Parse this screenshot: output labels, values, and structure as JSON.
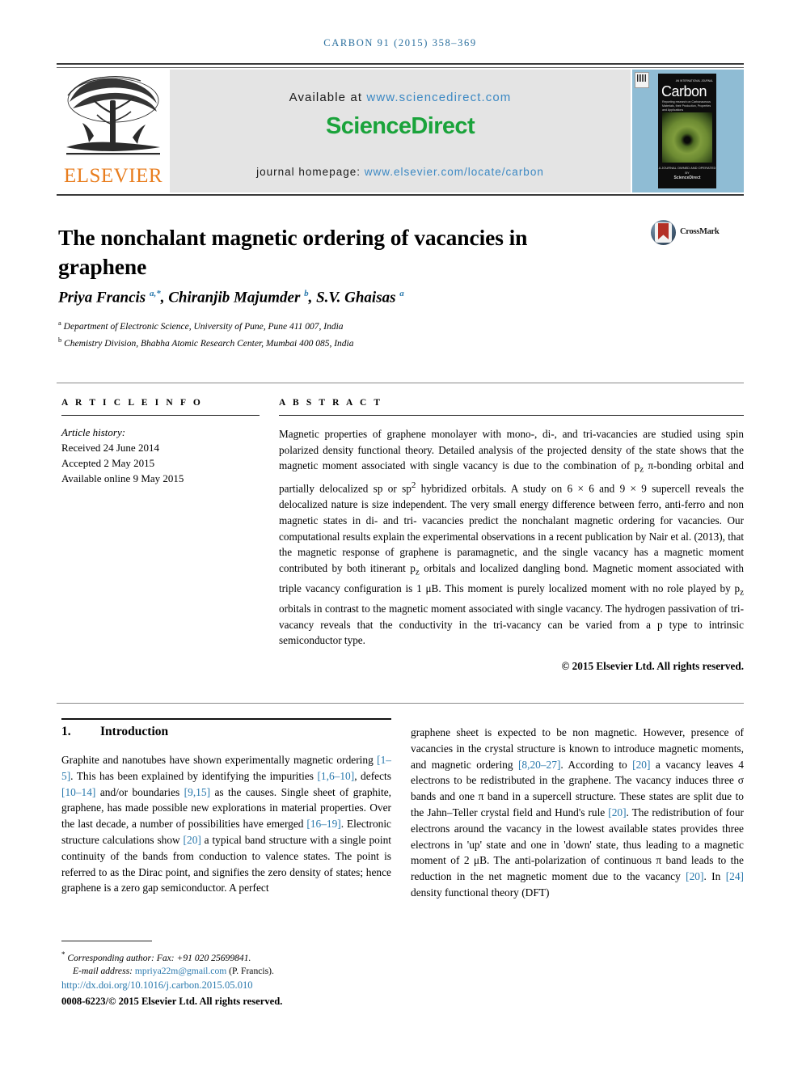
{
  "running_head": "CARBON 91 (2015) 358–369",
  "masthead": {
    "publisher_name": "ELSEVIER",
    "available_prefix": "Available at",
    "available_url": "www.sciencedirect.com",
    "sciencedirect_logo": "ScienceDirect",
    "homepage_prefix": "journal homepage:",
    "homepage_url": "www.elsevier.com/locate/carbon",
    "cover": {
      "journal_title": "Carbon",
      "tagline_top": "AN INTERNATIONAL JOURNAL",
      "subtitle": "Reporting research on Carbonaceous Materials, their Production, Properties and Applications",
      "footer_small": "A JOURNAL OWNED AND OPERATED BY",
      "footer_brand": "ScienceDirect"
    }
  },
  "article": {
    "title": "The nonchalant magnetic ordering of vacancies in graphene",
    "crossmark_label": "CrossMark",
    "authors_html": "Priya Francis <sup>a,*</sup>, Chiranjib Majumder <sup>b</sup>, S.V. Ghaisas <sup>a</sup>",
    "affiliations": [
      "Department of Electronic Science, University of Pune, Pune 411 007, India",
      "Chemistry Division, Bhabha Atomic Research Center, Mumbai 400 085, India"
    ],
    "affiliation_markers": [
      "a",
      "b"
    ]
  },
  "article_info": {
    "heading": "A R T I C L E   I N F O",
    "history_label": "Article history:",
    "history": [
      "Received 24 June 2014",
      "Accepted 2 May 2015",
      "Available online 9 May 2015"
    ]
  },
  "abstract": {
    "heading": "A B S T R A C T",
    "text": "Magnetic properties of graphene monolayer with mono-, di-, and tri-vacancies are studied using spin polarized density functional theory. Detailed analysis of the projected density of the state shows that the magnetic moment associated with single vacancy is due to the combination of pz π-bonding orbital and partially delocalized sp or sp2 hybridized orbitals. A study on 6 × 6 and 9 × 9 supercell reveals the delocalized nature is size independent. The very small energy difference between ferro, anti-ferro and non magnetic states in di- and tri- vacancies predict the nonchalant magnetic ordering for vacancies. Our computational results explain the experimental observations in a recent publication by Nair et al. (2013), that the magnetic response of graphene is paramagnetic, and the single vacancy has a magnetic moment contributed by both itinerant pz orbitals and localized dangling bond. Magnetic moment associated with triple vacancy configuration is 1 μB. This moment is purely localized moment with no role played by pz orbitals in contrast to the magnetic moment associated with single vacancy. The hydrogen passivation of tri-vacancy reveals that the conductivity in the tri-vacancy can be varied from a p type to intrinsic semiconductor type.",
    "copyright": "© 2015 Elsevier Ltd. All rights reserved."
  },
  "body": {
    "section_number": "1.",
    "section_title": "Introduction",
    "left_column_text": "Graphite and nanotubes have shown experimentally magnetic ordering [1–5]. This has been explained by identifying the impurities [1,6–10], defects [10–14] and/or boundaries [9,15] as the causes. Single sheet of graphite, graphene, has made possible new explorations in material properties. Over the last decade, a number of possibilities have emerged [16–19]. Electronic structure calculations show [20] a typical band structure with a single point continuity of the bands from conduction to valence states. The point is referred to as the Dirac point, and signifies the zero density of states; hence graphene is a zero gap semiconductor. A perfect",
    "right_column_text": "graphene sheet is expected to be non magnetic. However, presence of vacancies in the crystal structure is known to introduce magnetic moments, and magnetic ordering [8,20–27]. According to [20] a vacancy leaves 4 electrons to be redistributed in the graphene. The vacancy induces three σ bands and one π band in a supercell structure. These states are split due to the Jahn–Teller crystal field and Hund's rule [20]. The redistribution of four electrons around the vacancy in the lowest available states provides three electrons in 'up' state and one in 'down' state, thus leading to a magnetic moment of 2 μB. The anti-polarization of continuous π band leads to the reduction in the net magnetic moment due to the vacancy [20]. In [24] density functional theory (DFT)"
  },
  "footer": {
    "corresponding_marker": "*",
    "corresponding_text": "Corresponding author: Fax: +91 020 25699841.",
    "email_label": "E-mail address:",
    "email": "mpriya22m@gmail.com",
    "email_owner": "(P. Francis).",
    "doi": "http://dx.doi.org/10.1016/j.carbon.2015.05.010",
    "issn_line": "0008-6223/© 2015 Elsevier Ltd. All rights reserved."
  },
  "colors": {
    "link_blue": "#2a79ad",
    "sciencedirect_green": "#1aa33b",
    "elsevier_orange": "#E87D1E",
    "cover_blue": "#8fbcd4",
    "panel_gray": "#e4e4e4"
  }
}
